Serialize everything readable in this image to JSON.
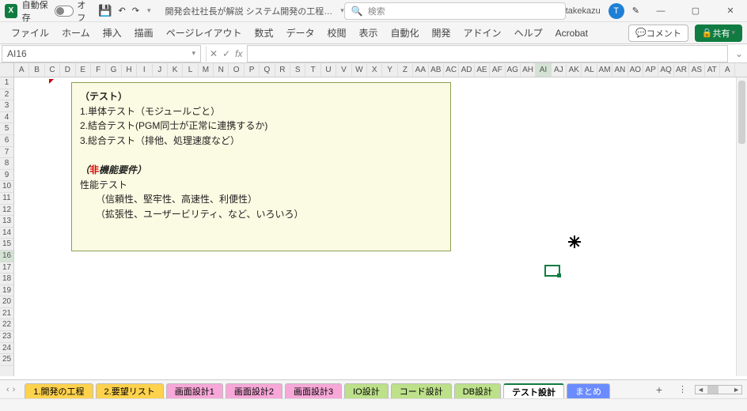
{
  "titlebar": {
    "autosave_label": "自動保存",
    "autosave_state": "オフ",
    "doc_title": "開発会社社長が解説 システム開発の工程…",
    "search_placeholder": "検索",
    "user_name": "takekazu",
    "user_initial": "T"
  },
  "ribbon": {
    "tabs": [
      "ファイル",
      "ホーム",
      "挿入",
      "描画",
      "ページレイアウト",
      "数式",
      "データ",
      "校閲",
      "表示",
      "自動化",
      "開発",
      "アドイン",
      "ヘルプ",
      "Acrobat"
    ],
    "comment_btn": "コメント",
    "share_btn": "共有"
  },
  "fx": {
    "cell_ref": "AI16",
    "formula": ""
  },
  "columns": [
    "A",
    "B",
    "C",
    "D",
    "E",
    "F",
    "G",
    "H",
    "I",
    "J",
    "K",
    "L",
    "M",
    "N",
    "O",
    "P",
    "Q",
    "R",
    "S",
    "T",
    "U",
    "V",
    "W",
    "X",
    "Y",
    "Z",
    "AA",
    "AB",
    "AC",
    "AD",
    "AE",
    "AF",
    "AG",
    "AH",
    "AI",
    "AJ",
    "AK",
    "AL",
    "AM",
    "AN",
    "AO",
    "AP",
    "AQ",
    "AR",
    "AS",
    "AT",
    "A"
  ],
  "selected_col_index": 34,
  "rows": [
    "1",
    "2",
    "3",
    "4",
    "5",
    "6",
    "7",
    "8",
    "9",
    "10",
    "11",
    "12",
    "13",
    "14",
    "15",
    "16",
    "17",
    "18",
    "19",
    "20",
    "21",
    "22",
    "23",
    "24",
    "25"
  ],
  "selected_row_index": 15,
  "textbox": {
    "h1": "（テスト）",
    "l1": "1.単体テスト（モジュールごと）",
    "l2": "2.結合テスト(PGM同士が正常に連携するか)",
    "l3": "3.総合テスト（排他、処理速度など）",
    "h2a": "（",
    "h2b": "非",
    "h2c": "機能要件）",
    "l4": "性能テスト",
    "l5": "（信頼性、堅牢性、高速性、利便性）",
    "l6": "（拡張性、ユーザービリティ、など、いろいろ）"
  },
  "sheets": [
    {
      "label": "1.開発の工程",
      "color": "#ffd24d"
    },
    {
      "label": "2.要望リスト",
      "color": "#ffd24d"
    },
    {
      "label": "画面設計1",
      "color": "#f7a8d8"
    },
    {
      "label": "画面設計2",
      "color": "#f7a8d8"
    },
    {
      "label": "画面設計3",
      "color": "#f7a8d8"
    },
    {
      "label": "IO設計",
      "color": "#bde08a"
    },
    {
      "label": "コード設計",
      "color": "#bde08a"
    },
    {
      "label": "DB設計",
      "color": "#bde08a"
    },
    {
      "label": "テスト設計",
      "color": "#ffffff",
      "active": true
    },
    {
      "label": "まとめ",
      "color": "#6b8cff",
      "text": "#fff"
    }
  ]
}
